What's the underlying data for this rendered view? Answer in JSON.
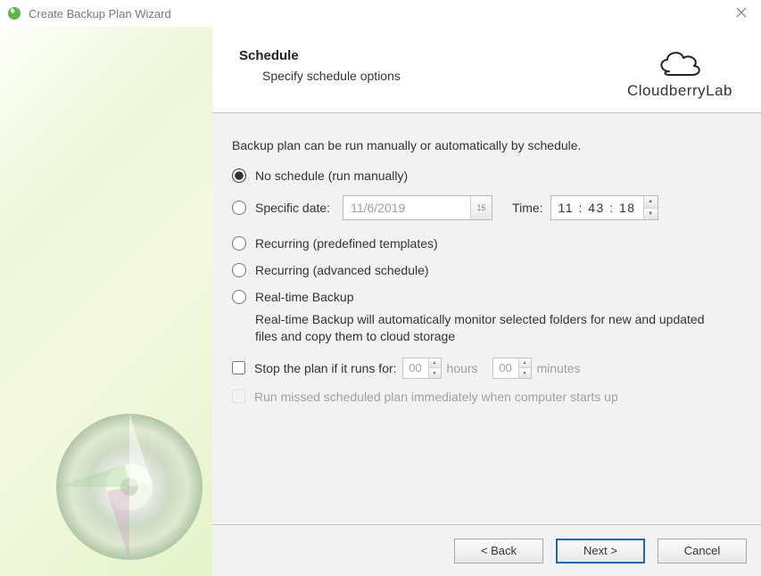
{
  "window": {
    "title": "Create Backup Plan Wizard"
  },
  "header": {
    "title": "Schedule",
    "subtitle": "Specify schedule options",
    "brand": "Cloudberry",
    "brand_suffix": "Lab"
  },
  "panel": {
    "intro": "Backup plan can be run manually or automatically by schedule.",
    "options": {
      "no_schedule": "No schedule (run manually)",
      "specific_date": "Specific date:",
      "recurring_predefined": "Recurring (predefined templates)",
      "recurring_advanced": "Recurring (advanced schedule)",
      "realtime": "Real-time Backup"
    },
    "date_value": "11/6/2019",
    "calendar_day": "15",
    "time_label": "Time:",
    "time_value": "11 : 43 : 18",
    "realtime_desc": "Real-time Backup will automatically monitor selected folders for new and updated files and copy them to cloud storage",
    "stop_plan_label": "Stop the plan if it runs for:",
    "hours_value": "00",
    "hours_unit": "hours",
    "minutes_value": "00",
    "minutes_unit": "minutes",
    "run_missed_label": "Run missed scheduled plan immediately when computer starts up"
  },
  "footer": {
    "back": "< Back",
    "next": "Next >",
    "cancel": "Cancel"
  }
}
